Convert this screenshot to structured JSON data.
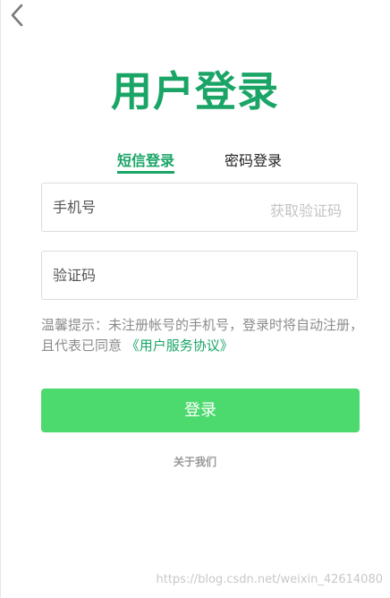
{
  "header": {
    "back_icon": "chevron-left-icon",
    "title": "用户登录"
  },
  "tabs": [
    {
      "label": "短信登录",
      "active": true
    },
    {
      "label": "密码登录",
      "active": false
    }
  ],
  "form": {
    "phone_placeholder": "手机号",
    "phone_value": "",
    "get_code_label": "获取验证码",
    "code_placeholder": "验证码",
    "code_value": ""
  },
  "tip": {
    "text": "温馨提示：未注册帐号的手机号，登录时将自动注册，且代表已同意",
    "agreement_link": "《用户服务协议》"
  },
  "login_button": "登录",
  "about_link": "关于我们",
  "watermark": "https://blog.csdn.net/weixin_42614080",
  "colors": {
    "brand_green": "#1aa567",
    "button_green": "#4cd96e",
    "muted_text": "#8c8c8c",
    "border": "#dcdcdc"
  }
}
